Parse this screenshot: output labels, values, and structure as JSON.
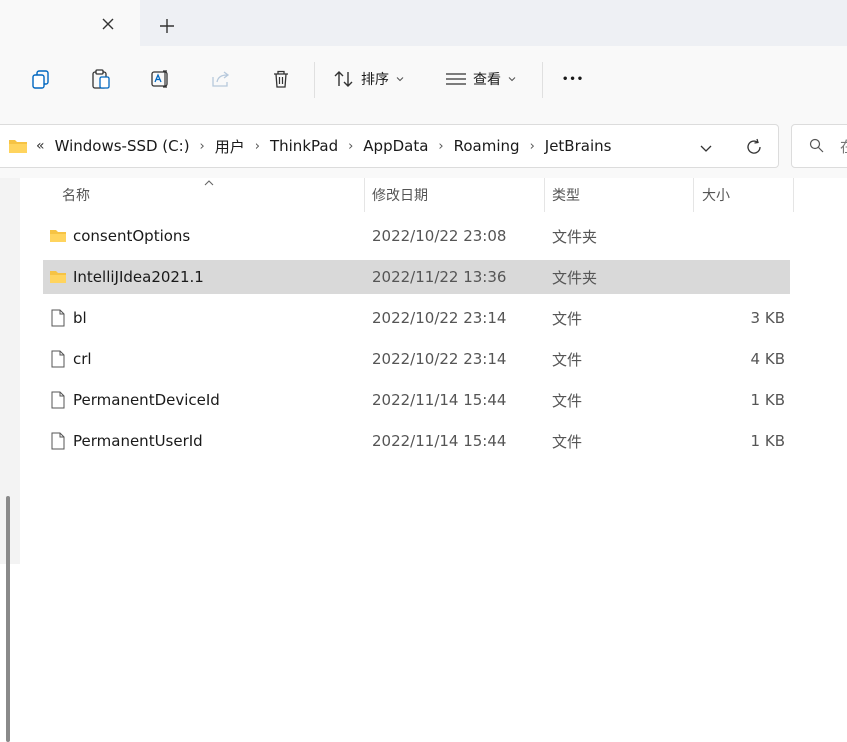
{
  "tabbar": {
    "close_glyph": "✕",
    "new_tab_glyph": "+"
  },
  "toolbar": {
    "sort_label": "排序",
    "view_label": "查看",
    "more_glyph": "•••"
  },
  "address": {
    "back_glyph": "«",
    "separator": "›",
    "crumbs": [
      "Windows-SSD (C:)",
      "用户",
      "ThinkPad",
      "AppData",
      "Roaming",
      "JetBrains"
    ]
  },
  "search": {
    "placeholder_partial": "在"
  },
  "columns": {
    "name": "名称",
    "date": "修改日期",
    "type": "类型",
    "size": "大小"
  },
  "files": [
    {
      "name": "consentOptions",
      "date": "2022/10/22 23:08",
      "type": "文件夹",
      "size": "",
      "icon": "folder-icon"
    },
    {
      "name": "IntelliJIdea2021.1",
      "date": "2022/11/22 13:36",
      "type": "文件夹",
      "size": "",
      "icon": "folder-icon",
      "selected": true
    },
    {
      "name": "bl",
      "date": "2022/10/22 23:14",
      "type": "文件",
      "size": "3 KB",
      "icon": "file-icon"
    },
    {
      "name": "crl",
      "date": "2022/10/22 23:14",
      "type": "文件",
      "size": "4 KB",
      "icon": "file-icon"
    },
    {
      "name": "PermanentDeviceId",
      "date": "2022/11/14 15:44",
      "type": "文件",
      "size": "1 KB",
      "icon": "file-icon"
    },
    {
      "name": "PermanentUserId",
      "date": "2022/11/14 15:44",
      "type": "文件",
      "size": "1 KB",
      "icon": "file-icon"
    }
  ],
  "colors": {
    "folder": "#f6c344",
    "selection": "#d9d9d9",
    "accent": "#0067c0"
  }
}
